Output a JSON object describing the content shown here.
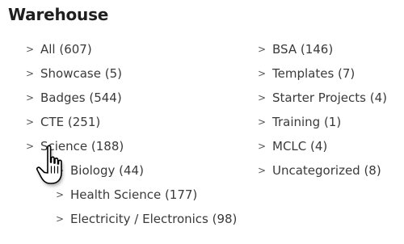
{
  "page": {
    "title": "Warehouse"
  },
  "categories": {
    "left": [
      {
        "label": "All (607)"
      },
      {
        "label": "Showcase (5)"
      },
      {
        "label": "Badges (544)"
      },
      {
        "label": "CTE (251)"
      },
      {
        "label": "Science (188)"
      }
    ],
    "science_children": [
      {
        "label": "Biology (44)"
      },
      {
        "label": "Health Science (177)"
      },
      {
        "label": "Electricity / Electronics (98)"
      }
    ],
    "right": [
      {
        "label": "BSA (146)"
      },
      {
        "label": "Templates (7)"
      },
      {
        "label": "Starter Projects (4)"
      },
      {
        "label": "Training (1)"
      },
      {
        "label": "MCLC (4)"
      },
      {
        "label": "Uncategorized (8)"
      }
    ],
    "chevron": ">"
  },
  "icons": {
    "cursor": "hand-pointer-icon"
  }
}
